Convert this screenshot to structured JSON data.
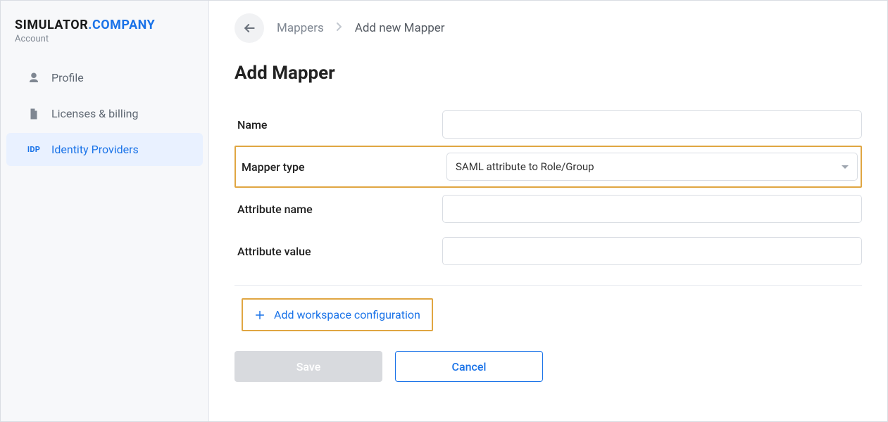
{
  "brand": {
    "part1": "SIMULATOR",
    "part2": ".COMPANY",
    "subtitle": "Account"
  },
  "sidebar": {
    "items": [
      {
        "label": "Profile",
        "icon": "user-icon",
        "active": false
      },
      {
        "label": "Licenses & billing",
        "icon": "file-icon",
        "active": false
      },
      {
        "label": "Identity Providers",
        "icon": "idp-icon",
        "badge": "IDP",
        "active": true
      }
    ]
  },
  "breadcrumb": {
    "back": "Back",
    "root": "Mappers",
    "current": "Add new Mapper"
  },
  "page": {
    "title": "Add Mapper"
  },
  "form": {
    "name": {
      "label": "Name",
      "value": ""
    },
    "mapper_type": {
      "label": "Mapper type",
      "value": "SAML attribute to Role/Group"
    },
    "attribute_name": {
      "label": "Attribute name",
      "value": ""
    },
    "attribute_value": {
      "label": "Attribute value",
      "value": ""
    },
    "add_config_label": "Add workspace configuration"
  },
  "actions": {
    "save": "Save",
    "cancel": "Cancel"
  }
}
